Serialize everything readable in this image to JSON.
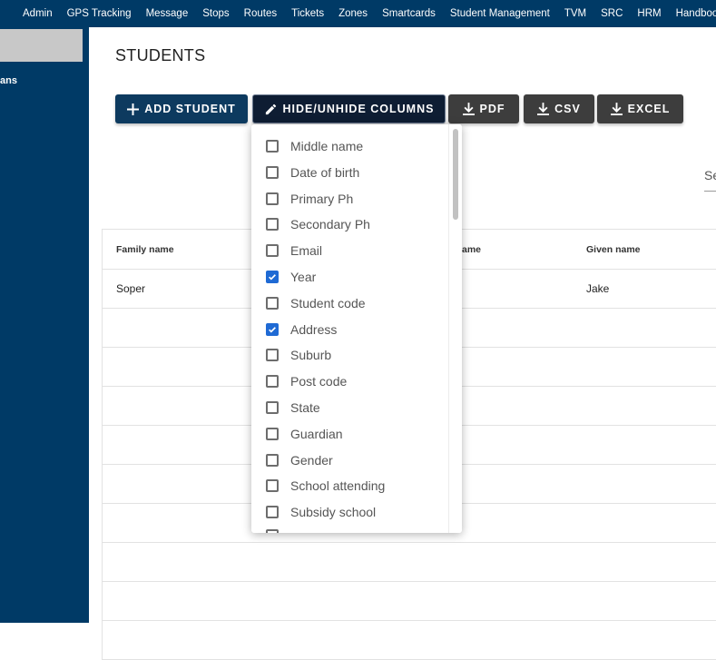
{
  "nav": {
    "items": [
      "Admin",
      "GPS Tracking",
      "Message",
      "Stops",
      "Routes",
      "Tickets",
      "Zones",
      "Smartcards",
      "Student Management",
      "TVM",
      "SRC",
      "HRM",
      "Handbooks"
    ]
  },
  "sidebar": {
    "item_fragment": "ans"
  },
  "page": {
    "title": "STUDENTS"
  },
  "toolbar": {
    "add_label": "ADD STUDENT",
    "hide_label": "HIDE/UNHIDE COLUMNS",
    "pdf_label": "PDF",
    "csv_label": "CSV",
    "excel_label": "EXCEL"
  },
  "search": {
    "placeholder_fragment": "Se"
  },
  "table": {
    "headers": [
      "Family name",
      "ame",
      "Given name"
    ],
    "rows": [
      [
        "Soper",
        "",
        "Jake"
      ]
    ]
  },
  "columns_menu": {
    "items": [
      {
        "label": "Middle name",
        "checked": false
      },
      {
        "label": "Date of birth",
        "checked": false
      },
      {
        "label": "Primary Ph",
        "checked": false
      },
      {
        "label": "Secondary Ph",
        "checked": false
      },
      {
        "label": "Email",
        "checked": false
      },
      {
        "label": "Year",
        "checked": true
      },
      {
        "label": "Student code",
        "checked": false
      },
      {
        "label": "Address",
        "checked": true
      },
      {
        "label": "Suburb",
        "checked": false
      },
      {
        "label": "Post code",
        "checked": false
      },
      {
        "label": "State",
        "checked": false
      },
      {
        "label": "Guardian",
        "checked": false
      },
      {
        "label": "Gender",
        "checked": false
      },
      {
        "label": "School attending",
        "checked": false
      },
      {
        "label": "Subsidy school",
        "checked": false
      }
    ]
  },
  "colors": {
    "nav_bg": "#003a66",
    "primary_button": "#0d3a5f",
    "export_button": "#3d3d3d",
    "checkbox_checked": "#1f6ad4"
  }
}
